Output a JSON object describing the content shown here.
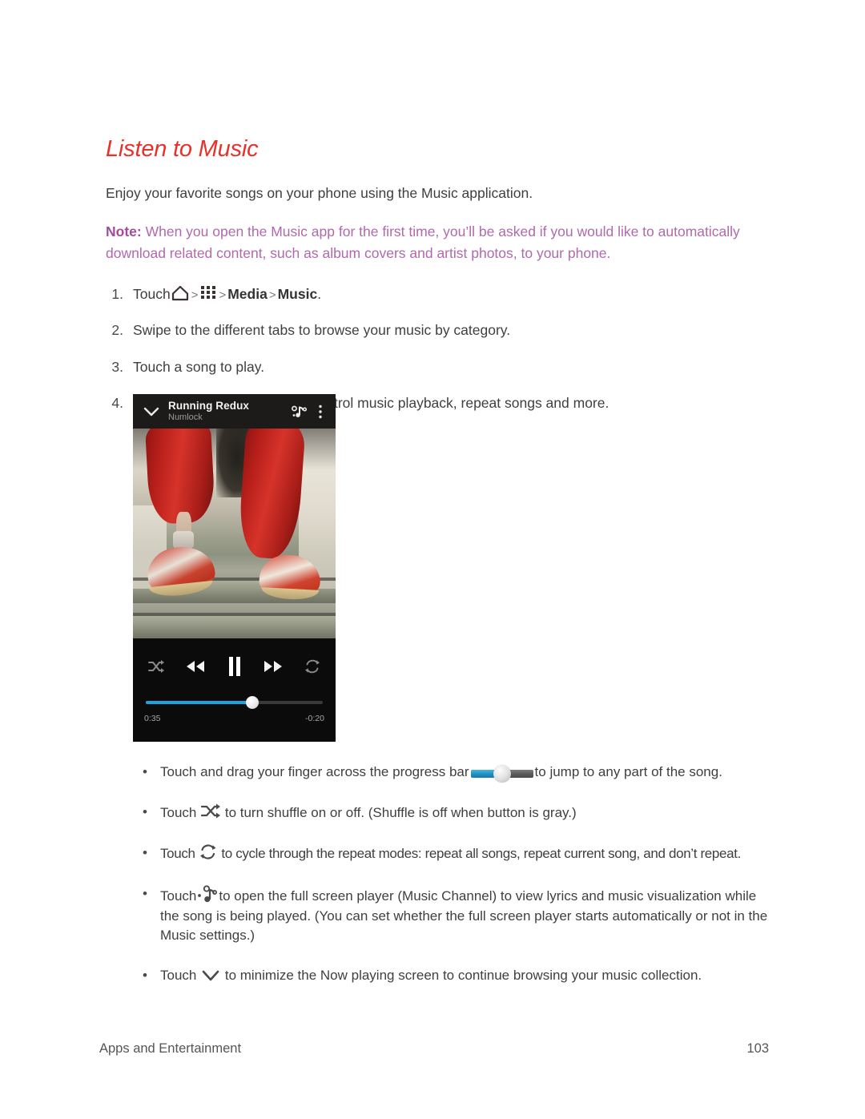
{
  "heading": "Listen to Music",
  "intro": "Enjoy your favorite songs on your phone using the Music application.",
  "note": {
    "label": "Note:",
    "text": "When you open the Music app for the first time, you’ll be asked if you would like to automatically download related content, such as album covers and artist photos, to your phone."
  },
  "steps": [
    {
      "num": "1.",
      "prefix": "Touch",
      "icons": [
        "home-icon",
        "apps-grid-icon"
      ],
      "sep": ">",
      "bold1": "Media",
      "bold2": "Music",
      "suffix": "."
    },
    {
      "num": "2.",
      "text": "Swipe to the different tabs to browse your music by category."
    },
    {
      "num": "3.",
      "text": "Touch a song to play."
    },
    {
      "num": "4.",
      "text": "Touch the onscreen icons to control music playback, repeat songs and more."
    }
  ],
  "device": {
    "topbar": {
      "chevron_icon": "chevron-down-icon",
      "title": "Running Redux",
      "subtitle": "Numlock",
      "music_channel_icon": "music-channel-icon",
      "overflow_icon": "more-vertical-icon"
    },
    "controls": {
      "shuffle_icon": "shuffle-icon",
      "rewind_icon": "rewind-icon",
      "pause_icon": "pause-icon",
      "forward_icon": "fast-forward-icon",
      "repeat_icon": "repeat-icon",
      "progress_percent": 60,
      "elapsed_time": "0:35",
      "remaining_time": "-0:20",
      "progress_color": "#1fa3de",
      "track_color": "#3a3a3a"
    }
  },
  "bullets": [
    {
      "dot": "•",
      "lead": "Touch and drag your finger across the progress bar",
      "icon": "progress-bar-graphic",
      "tail": "to jump to any part of the song."
    },
    {
      "dot": "•",
      "lead": "Touch",
      "icon": "shuffle-icon",
      "tail": "to turn shuffle on or off. (Shuffle is off when button is gray.)"
    },
    {
      "dot": "•",
      "lead": "Touch",
      "icon": "repeat-icon",
      "tail": "to cycle through the repeat modes: repeat all songs, repeat current song, and don’t repeat."
    },
    {
      "dot": "•",
      "lead": "Touch",
      "icon": "music-channel-icon",
      "tail": "to open the full screen player (Music Channel) to view lyrics and music visualization while the song is being played. (You can set whether the full screen player starts automatically or not in the Music settings.)"
    },
    {
      "dot": "•",
      "lead": "Touch",
      "icon": "chevron-down-icon",
      "tail": "to minimize the Now playing screen to continue browsing your music collection."
    }
  ],
  "footer": {
    "section": "Apps and Entertainment",
    "page_number": "103"
  },
  "colors": {
    "heading": "#e8312a",
    "note": "#b069ad",
    "note_label": "#a3499e",
    "body": "#3f3f3f",
    "accent_progress": "#1fa3de"
  }
}
